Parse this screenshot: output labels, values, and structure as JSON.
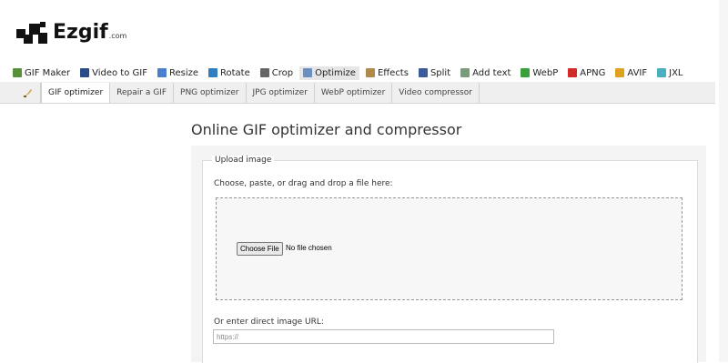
{
  "logo": {
    "text": "Ezgif",
    "suffix": ".com"
  },
  "main_nav": [
    {
      "label": "GIF Maker",
      "icon": "gif-maker-icon",
      "color": "#5a8f3a"
    },
    {
      "label": "Video to GIF",
      "icon": "video-icon",
      "color": "#2b4a8a"
    },
    {
      "label": "Resize",
      "icon": "resize-icon",
      "color": "#4a7fd0"
    },
    {
      "label": "Rotate",
      "icon": "rotate-icon",
      "color": "#2f7fc0"
    },
    {
      "label": "Crop",
      "icon": "crop-icon",
      "color": "#666666"
    },
    {
      "label": "Optimize",
      "icon": "optimize-icon",
      "color": "#6b8fc0"
    },
    {
      "label": "Effects",
      "icon": "effects-icon",
      "color": "#b08a4a"
    },
    {
      "label": "Split",
      "icon": "split-icon",
      "color": "#3a5a9a"
    },
    {
      "label": "Add text",
      "icon": "add-text-icon",
      "color": "#7a9a7a"
    },
    {
      "label": "WebP",
      "icon": "webp-icon",
      "color": "#3aa03a"
    },
    {
      "label": "APNG",
      "icon": "apng-icon",
      "color": "#d02a2a"
    },
    {
      "label": "AVIF",
      "icon": "avif-icon",
      "color": "#e0a020"
    },
    {
      "label": "JXL",
      "icon": "jxl-icon",
      "color": "#4ab0c0"
    }
  ],
  "sub_nav": [
    "GIF optimizer",
    "Repair a GIF",
    "PNG optimizer",
    "JPG optimizer",
    "WebP optimizer",
    "Video compressor"
  ],
  "page_title": "Online GIF optimizer and compressor",
  "upload": {
    "legend": "Upload image",
    "choose_label": "Choose, paste, or drag and drop a file here:",
    "file_button": "Choose File",
    "no_file": "No file chosen",
    "url_label": "Or enter direct image URL:",
    "url_placeholder": "https://"
  }
}
